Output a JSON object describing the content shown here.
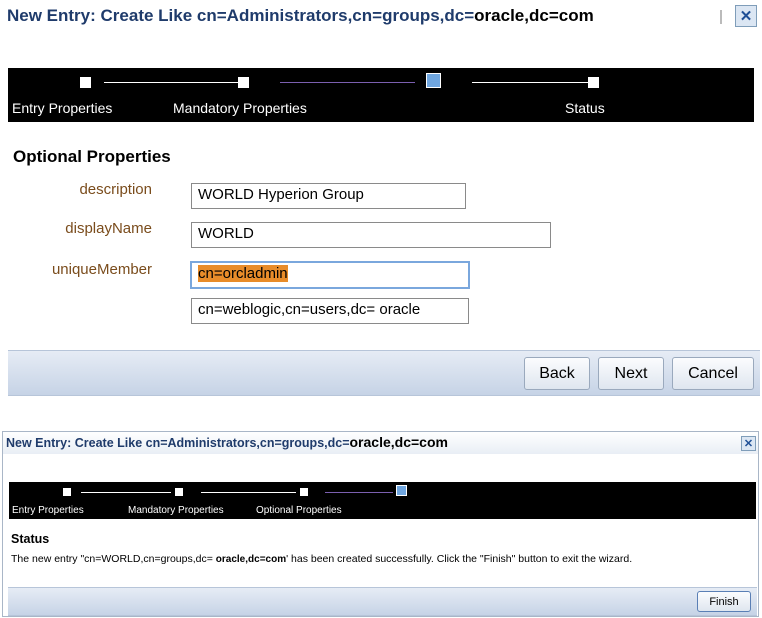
{
  "top_dialog": {
    "title_prefix": "New Entry: Create Like cn=Administrators,cn=groups,dc=",
    "title_host": "oracle,dc=com",
    "close_symbol": "✕",
    "train": {
      "steps": [
        {
          "label": "Entry Properties",
          "state": "visited"
        },
        {
          "label": "Mandatory Properties",
          "state": "visited"
        },
        {
          "label": "",
          "state": "current"
        },
        {
          "label": "Status",
          "state": "pending"
        }
      ]
    },
    "section_title": "Optional Properties",
    "fields": {
      "description_label": "description",
      "description_value": "WORLD Hyperion Group",
      "displayname_label": "displayName",
      "displayname_value": "WORLD",
      "uniquemember_label": "uniqueMember",
      "uniquemember_value_1": "cn=orcladmin",
      "uniquemember_value_2": "cn=weblogic,cn=users,dc= oracle"
    },
    "buttons": {
      "back": "Back",
      "next": "Next",
      "cancel": "Cancel"
    }
  },
  "bottom_dialog": {
    "title_prefix": "New Entry: Create Like cn=Administrators,cn=groups,dc=",
    "title_host": "oracle,dc=com",
    "close_symbol": "✕",
    "train": {
      "steps": [
        {
          "label": "Entry Properties",
          "state": "visited"
        },
        {
          "label": "Mandatory Properties",
          "state": "visited"
        },
        {
          "label": "Optional Properties",
          "state": "visited"
        },
        {
          "label": "",
          "state": "current"
        }
      ]
    },
    "status_title": "Status",
    "status_message_prefix": "The new entry \"cn=WORLD,cn=groups,dc= ",
    "status_message_host": "oracle,dc=com",
    "status_message_suffix": "' has been created successfully. Click the \"Finish\" button to exit the wizard.",
    "buttons": {
      "finish": "Finish"
    }
  },
  "colors": {
    "title_text": "#1f3b6b",
    "label_text": "#7a4c1c",
    "train_background": "#000000",
    "current_step": "#6fa6e0",
    "highlight": "#e88c2a"
  }
}
